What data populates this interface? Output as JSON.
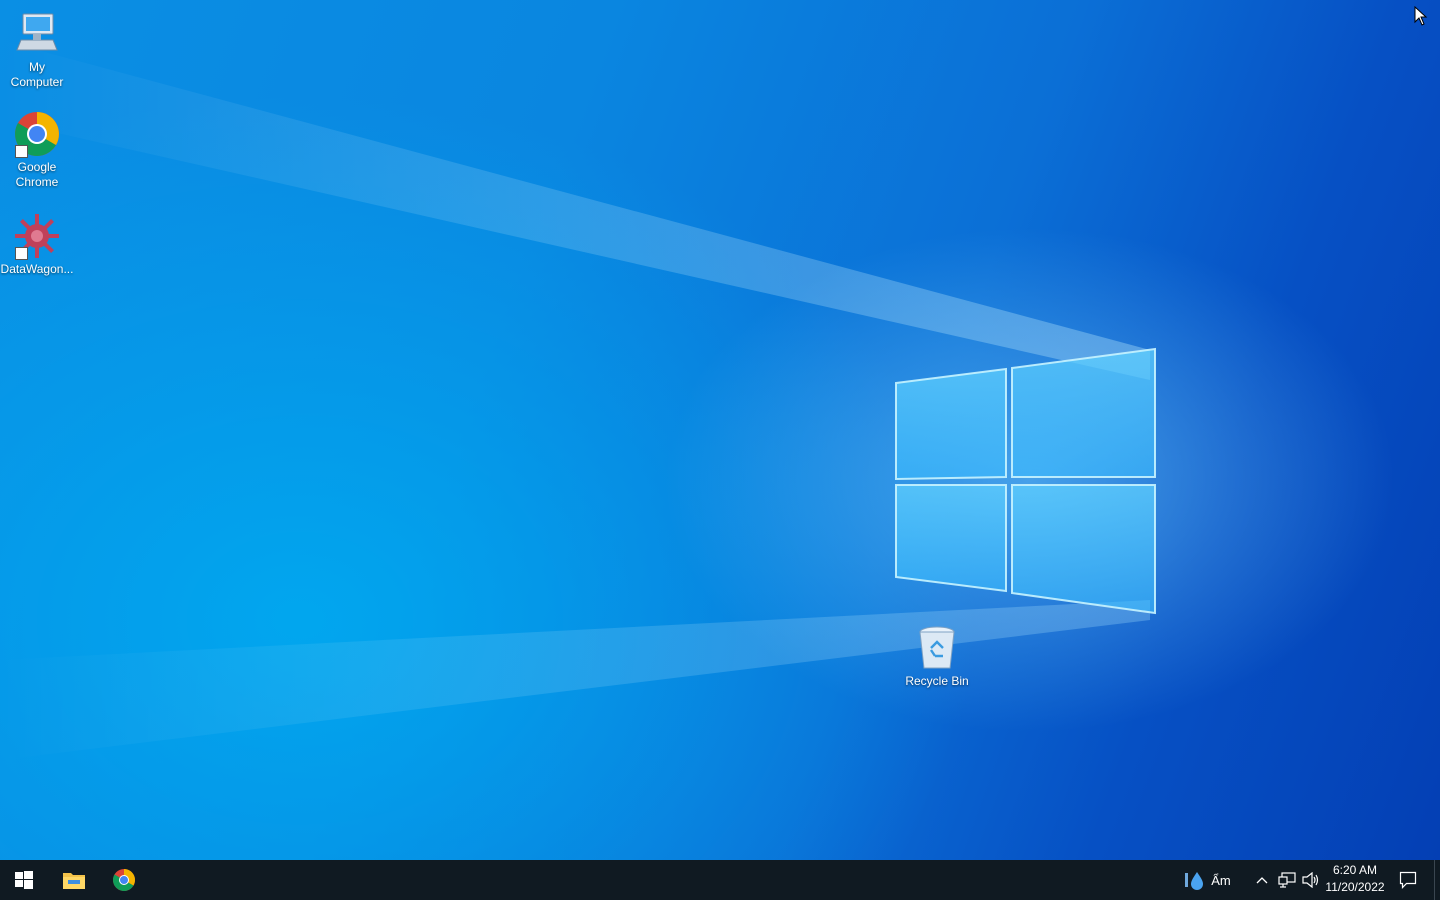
{
  "desktop": {
    "icons": [
      {
        "label": "My\nComputer",
        "icon": "computer-icon"
      },
      {
        "label": "Google\nChrome",
        "icon": "chrome-icon"
      },
      {
        "label": "DataWagon...",
        "icon": "datawagon-icon"
      },
      {
        "label": "Recycle Bin",
        "icon": "recycle-bin-icon"
      }
    ]
  },
  "taskbar": {
    "start_icon": "windows-start-icon",
    "pinned": [
      {
        "name": "File Explorer",
        "icon": "folder-icon"
      },
      {
        "name": "Google Chrome",
        "icon": "chrome-icon"
      }
    ],
    "weather": {
      "icon": "weather-rain-icon",
      "text": "Ẩm"
    },
    "tray_icons": [
      "chevron-up-icon",
      "network-icon",
      "volume-icon"
    ],
    "clock": {
      "time": "6:20 AM",
      "date": "11/20/2022"
    },
    "notification_icon": "notification-icon"
  },
  "colors": {
    "taskbar": "#101a22",
    "desktop_accent": "#0a86e0"
  }
}
